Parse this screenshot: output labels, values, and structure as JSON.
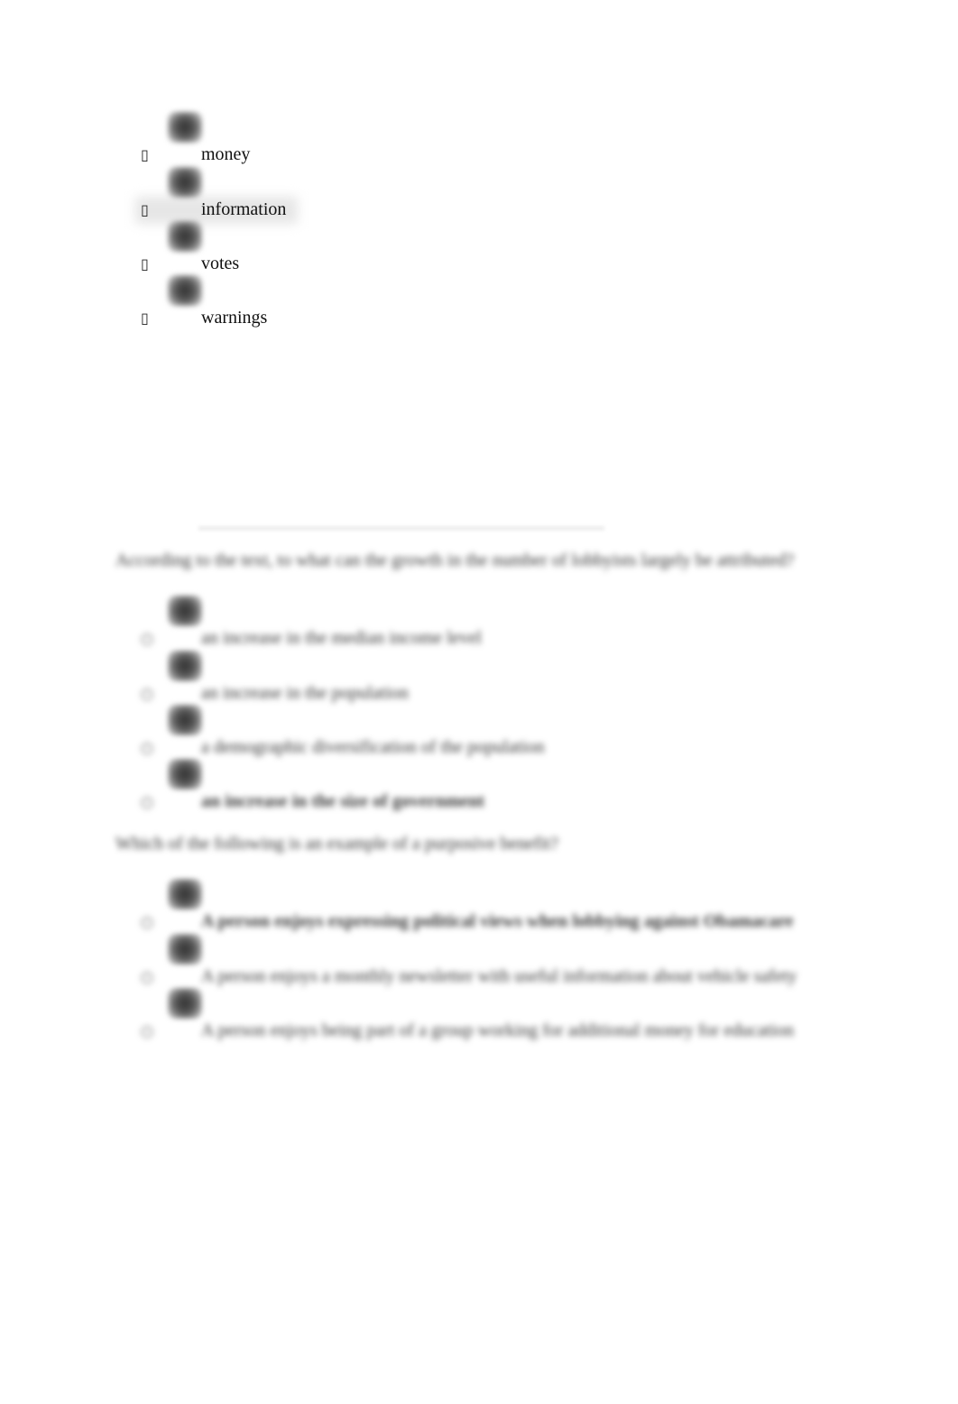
{
  "question_1": {
    "options": [
      {
        "label": "money",
        "bullet": "▯"
      },
      {
        "label": "information",
        "bullet": "▯"
      },
      {
        "label": "votes",
        "bullet": "▯"
      },
      {
        "label": "warnings",
        "bullet": "▯"
      }
    ]
  },
  "question_2": {
    "prompt": "According to the text, to what can the growth in the number of lobbyists largely be attributed?",
    "options": [
      {
        "label": "an increase in the median income level",
        "bullet": "○"
      },
      {
        "label": "an increase in the population",
        "bullet": "○"
      },
      {
        "label": "a demographic diversification of the population",
        "bullet": "○"
      },
      {
        "label": "an increase in the size of government",
        "bullet": "○"
      }
    ]
  },
  "question_3": {
    "prompt": "Which of the following is an example of a purposive benefit?",
    "options": [
      {
        "label": "A person enjoys expressing political views when lobbying against Obamacare",
        "bullet": "○"
      },
      {
        "label": "A person enjoys a monthly newsletter with useful information about vehicle safety",
        "bullet": "○"
      },
      {
        "label": "A person enjoys being part of a group working for additional money for education",
        "bullet": "○"
      }
    ]
  }
}
